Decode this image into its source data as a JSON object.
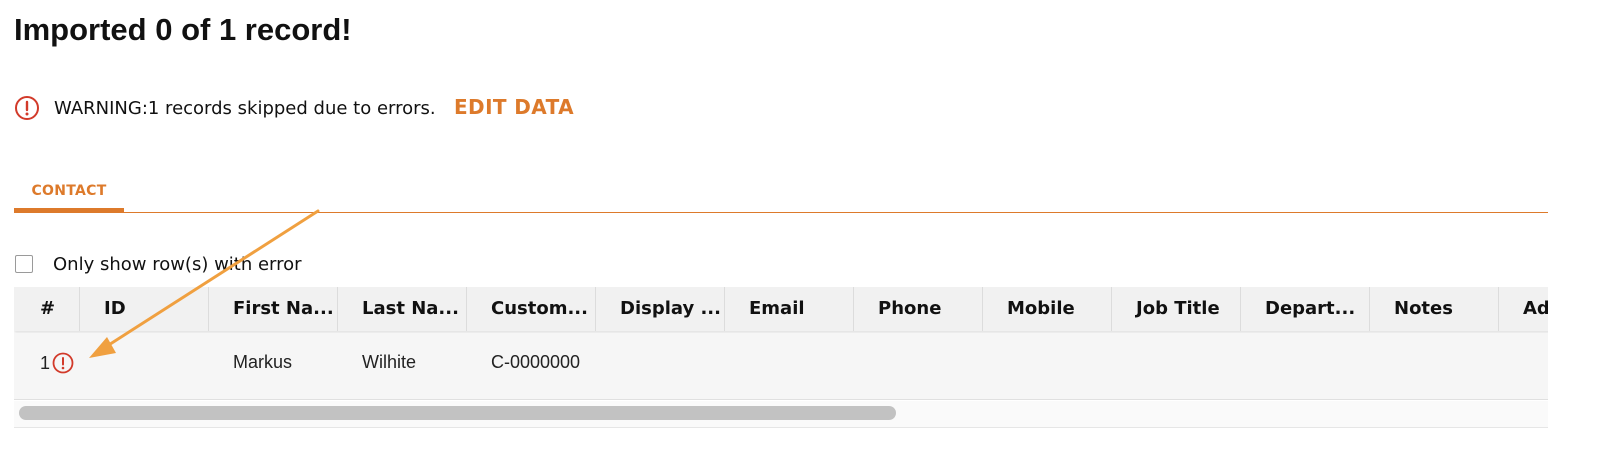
{
  "page": {
    "title": "Imported 0 of 1 record!"
  },
  "warning": {
    "icon": "error-circle-icon",
    "text": "WARNING:1 records skipped due to errors.",
    "edit_label": "EDIT DATA"
  },
  "tabs": [
    {
      "label": "CONTACT",
      "active": true
    }
  ],
  "filter": {
    "label": "Only show row(s) with error",
    "checked": false
  },
  "grid": {
    "columns": [
      "#",
      "ID",
      "First Na...",
      "Last Na...",
      "Custom...",
      "Display ...",
      "Email",
      "Phone",
      "Mobile",
      "Job Title",
      "Depart...",
      "Notes",
      "Ad"
    ],
    "rows": [
      {
        "num": "1",
        "has_error": true,
        "id": "",
        "first_name": "Markus",
        "last_name": "Wilhite",
        "customer": "C-0000000",
        "display": "",
        "email": "",
        "phone": "",
        "mobile": "",
        "job_title": "",
        "department": "",
        "notes": ""
      }
    ]
  },
  "colors": {
    "accent": "#dd7a2b",
    "error": "#d23a2a",
    "annotation_arrow": "#f0a040"
  }
}
